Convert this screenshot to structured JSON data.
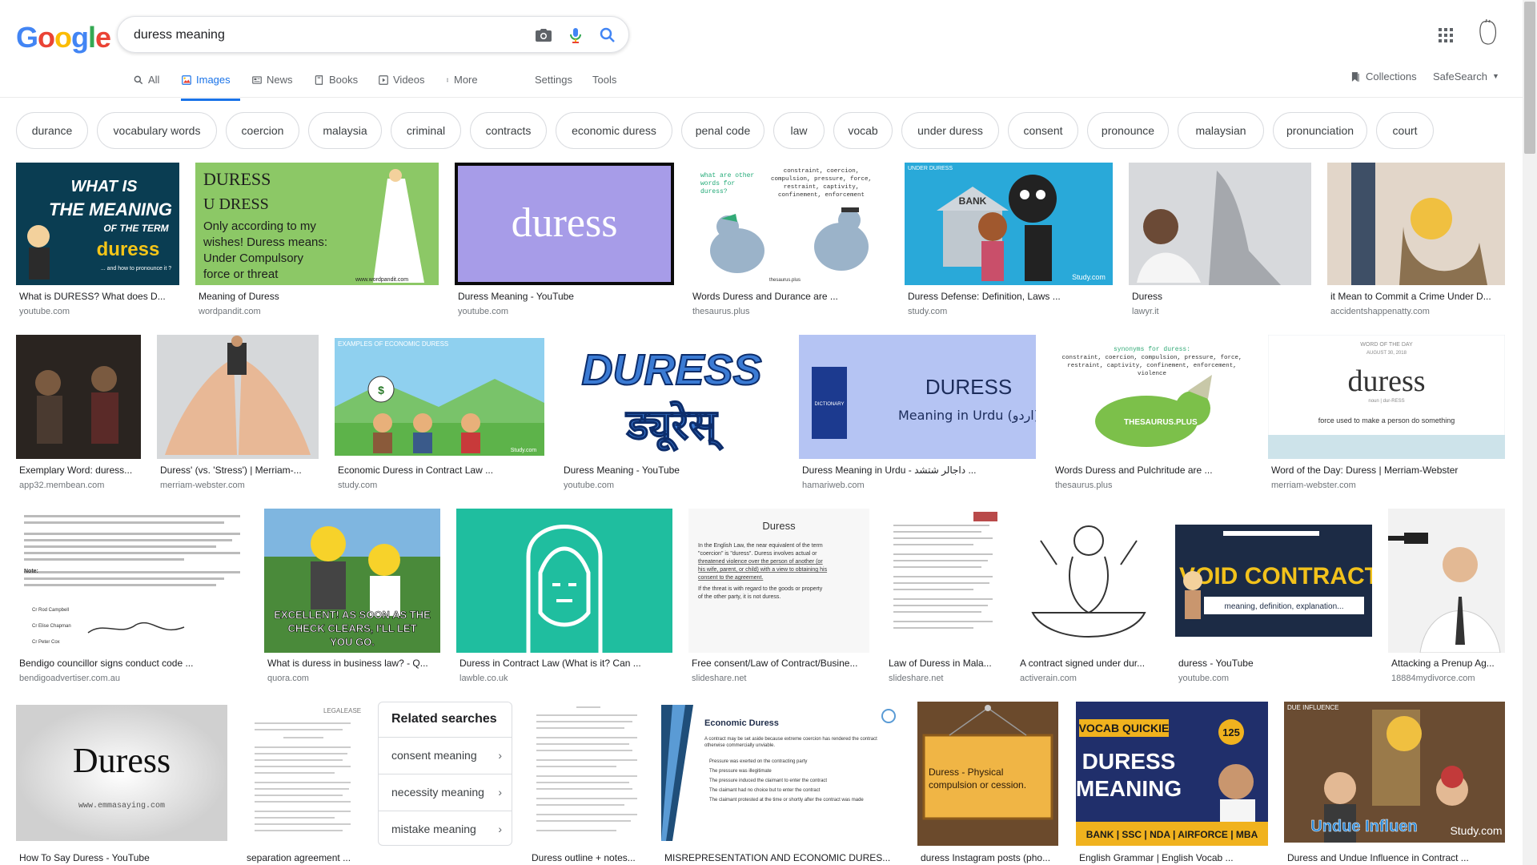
{
  "logo": {
    "letters": [
      "G",
      "o",
      "o",
      "g",
      "l",
      "e"
    ]
  },
  "search": {
    "value": "duress meaning",
    "camera_icon": "camera-icon",
    "mic_icon": "mic-icon",
    "search_icon": "search-icon"
  },
  "tabs": [
    {
      "label": "All",
      "icon": "search-icon"
    },
    {
      "label": "Images",
      "icon": "image-icon"
    },
    {
      "label": "News",
      "icon": "news-icon"
    },
    {
      "label": "Books",
      "icon": "book-icon"
    },
    {
      "label": "Videos",
      "icon": "video-icon"
    },
    {
      "label": "More",
      "icon": "more-vert-icon"
    }
  ],
  "tools": {
    "settings": "Settings",
    "tools": "Tools"
  },
  "right_nav": {
    "collections": "Collections",
    "safesearch": "SafeSearch"
  },
  "chips": [
    "durance",
    "vocabulary words",
    "coercion",
    "malaysia",
    "criminal",
    "contracts",
    "economic duress",
    "penal code",
    "law",
    "vocab",
    "under duress",
    "consent",
    "pronounce",
    "malaysian",
    "pronunciation",
    "court"
  ],
  "row1": [
    {
      "caption": "What is DURESS? What does D...",
      "source": "youtube.com",
      "thumb_text": [
        "WHAT IS",
        "THE MEANING",
        "OF THE TERM",
        "duress",
        "... and how to pronounce it ?"
      ]
    },
    {
      "caption": "Meaning of Duress",
      "source": "wordpandit.com",
      "thumb_text": [
        "DURESS",
        "U DRESS",
        "Only according to my",
        "wishes! Duress means:",
        "Under Compulsory",
        "force or threat",
        "www.wordpandit.com"
      ]
    },
    {
      "caption": "Duress Meaning - YouTube",
      "source": "youtube.com",
      "thumb_text": [
        "duress"
      ]
    },
    {
      "caption": "Words Duress and Durance are ...",
      "source": "thesaurus.plus",
      "thumb_text": [
        "what are other",
        "words for",
        "duress?",
        "constraint, coercion,",
        "compulsion, pressure, force,",
        "restraint, captivity,",
        "confinement, enforcement",
        "thesaurus.plus"
      ]
    },
    {
      "caption": "Duress Defense: Definition, Laws ...",
      "source": "study.com",
      "thumb_text": [
        "UNDER DURESS",
        "BANK",
        "Study.com"
      ]
    },
    {
      "caption": "Duress",
      "source": "lawyr.it",
      "thumb_text": []
    },
    {
      "caption": "it Mean to Commit a Crime Under D...",
      "source": "accidentshappenatty.com",
      "thumb_text": []
    }
  ],
  "row2": [
    {
      "caption": "Exemplary Word: duress...",
      "source": "app32.membean.com",
      "thumb_text": []
    },
    {
      "caption": "Duress' (vs. 'Stress') | Merriam-...",
      "source": "merriam-webster.com",
      "thumb_text": []
    },
    {
      "caption": "Economic Duress in Contract Law ...",
      "source": "study.com",
      "thumb_text": [
        "EXAMPLES OF ECONOMIC DURESS",
        "Study.com"
      ]
    },
    {
      "caption": "Duress Meaning - YouTube",
      "source": "youtube.com",
      "thumb_text": [
        "DURESS",
        "ड्यूरेस्"
      ]
    },
    {
      "caption": "Duress Meaning in Urdu - داجالر شتشد ...",
      "source": "hamariweb.com",
      "thumb_text": [
        "DICTIONARY",
        "DURESS",
        "Meaning in Urdu (اردو)"
      ]
    },
    {
      "caption": "Words Duress and Pulchritude are ...",
      "source": "thesaurus.plus",
      "thumb_text": [
        "synonyms for duress:",
        "constraint, coercion, compulsion, pressure, force,",
        "restraint, captivity, confinement, enforcement,",
        "violence",
        "THESAURUS.PLUS"
      ]
    },
    {
      "caption": "Word of the Day: Duress | Merriam-Webster",
      "source": "merriam-webster.com",
      "thumb_text": [
        "WORD OF THE DAY",
        "AUGUST 30, 2018",
        "duress",
        "noun | dur-RESS",
        "force used to make a person do something"
      ]
    }
  ],
  "row3": [
    {
      "caption": "Bendigo councillor signs conduct code ...",
      "source": "bendigoadvertiser.com.au",
      "thumb_text": [
        "Note:",
        "Cr Rod Campbell",
        "Cr Elise Chapman",
        "Cr Peter Cox"
      ]
    },
    {
      "caption": "What is duress in business law? - Q...",
      "source": "quora.com",
      "thumb_text": [
        "EXCELLENT! AS SOON AS THE",
        "CHECK CLEARS, I'LL LET",
        "YOU GO."
      ]
    },
    {
      "caption": "Duress in Contract Law (What is it? Can ...",
      "source": "lawble.co.uk",
      "thumb_text": []
    },
    {
      "caption": "Free consent/Law of Contract/Busine...",
      "source": "slideshare.net",
      "thumb_text": [
        "Duress",
        "In the English Law, the near equivalent of the term",
        "\"coercion\" is \"duress\". Duress involves actual or",
        "threatened violence over the person of another (or",
        "his wife, parent, or child) with a view to obtaining his",
        "consent to the agreement.",
        "If the threat is with regard to the goods or property",
        "of the other party, it is not duress."
      ]
    },
    {
      "caption": "Law of Duress in Mala...",
      "source": "slideshare.net",
      "thumb_text": []
    },
    {
      "caption": "A contract signed under dur...",
      "source": "activerain.com",
      "thumb_text": []
    },
    {
      "caption": "duress - YouTube",
      "source": "youtube.com",
      "thumb_text": [
        "VOID CONTRACT",
        "meaning, definition, explanation..."
      ]
    },
    {
      "caption": "Attacking a Prenup Ag...",
      "source": "18884mydivorce.com",
      "thumb_text": []
    }
  ],
  "row4": [
    {
      "caption": "How To Say Duress - YouTube",
      "source": "",
      "thumb_text": [
        "Duress",
        "www.emmasaying.com"
      ]
    },
    {
      "caption": "separation agreement ...",
      "source": "",
      "thumb_text": [
        "LEGALEASE"
      ]
    },
    {
      "caption": "Duress outline + notes...",
      "source": "",
      "thumb_text": []
    },
    {
      "caption": "MISREPRESENTATION AND ECONOMIC DURES...",
      "source": "",
      "thumb_text": [
        "Economic Duress",
        "A contract may be set aside because extreme coercion has rendered the contract",
        "otherwise commercially unviable.",
        "Pressure was exerted on the contracting party",
        "The pressure was illegitimate",
        "The pressure induced the claimant to enter the contract",
        "The claimant had no choice but to enter the contract",
        "The claimant protested at the time or shortly after the contract was made"
      ]
    },
    {
      "caption": "duress Instagram posts (pho...",
      "source": "",
      "thumb_text": [
        "Duress - Physical",
        "compulsion or cession."
      ]
    },
    {
      "caption": "English Grammar | English Vocab ...",
      "source": "",
      "thumb_text": [
        "VOCAB QUICKIE",
        "125",
        "DURESS",
        "MEANING",
        "BANK | SSC | NDA | AIRFORCE | MBA"
      ]
    },
    {
      "caption": "Duress and Undue Influence in Contract ...",
      "source": "",
      "thumb_text": [
        "DUE INFLUENCE",
        "Undue Influen",
        "Study.com"
      ]
    }
  ],
  "related": {
    "title": "Related searches",
    "items": [
      "consent meaning",
      "necessity meaning",
      "mistake meaning"
    ]
  },
  "colors": {
    "accent": "#1a73e8",
    "chip_border": "#dadce0",
    "caption": "#202124",
    "source": "#70757a"
  }
}
